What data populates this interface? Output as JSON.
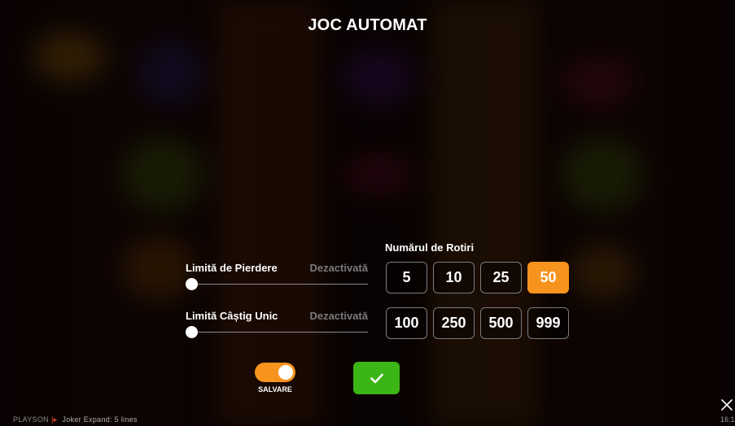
{
  "title": "JOC AUTOMAT",
  "loss_limit": {
    "label": "Limită de Pierdere",
    "state": "Dezactivată",
    "level": 0
  },
  "win_limit": {
    "label": "Limită Câștig Unic",
    "state": "Dezactivată",
    "level": 0
  },
  "spins": {
    "title": "Numărul de Rotiri",
    "options": [
      "5",
      "10",
      "25",
      "50",
      "100",
      "250",
      "500",
      "999"
    ],
    "selected": "50"
  },
  "save": {
    "label": "SALVARE",
    "enabled": true
  },
  "footer": {
    "brand": "PLAYSON",
    "game": "Joker Expand: 5 lines",
    "clock": "16:1"
  },
  "colors": {
    "accent": "#f7941d",
    "confirm": "#3cb516",
    "muted": "#7a7a7a"
  },
  "icons": {
    "confirm": "checkmark-icon",
    "close": "close-icon"
  }
}
